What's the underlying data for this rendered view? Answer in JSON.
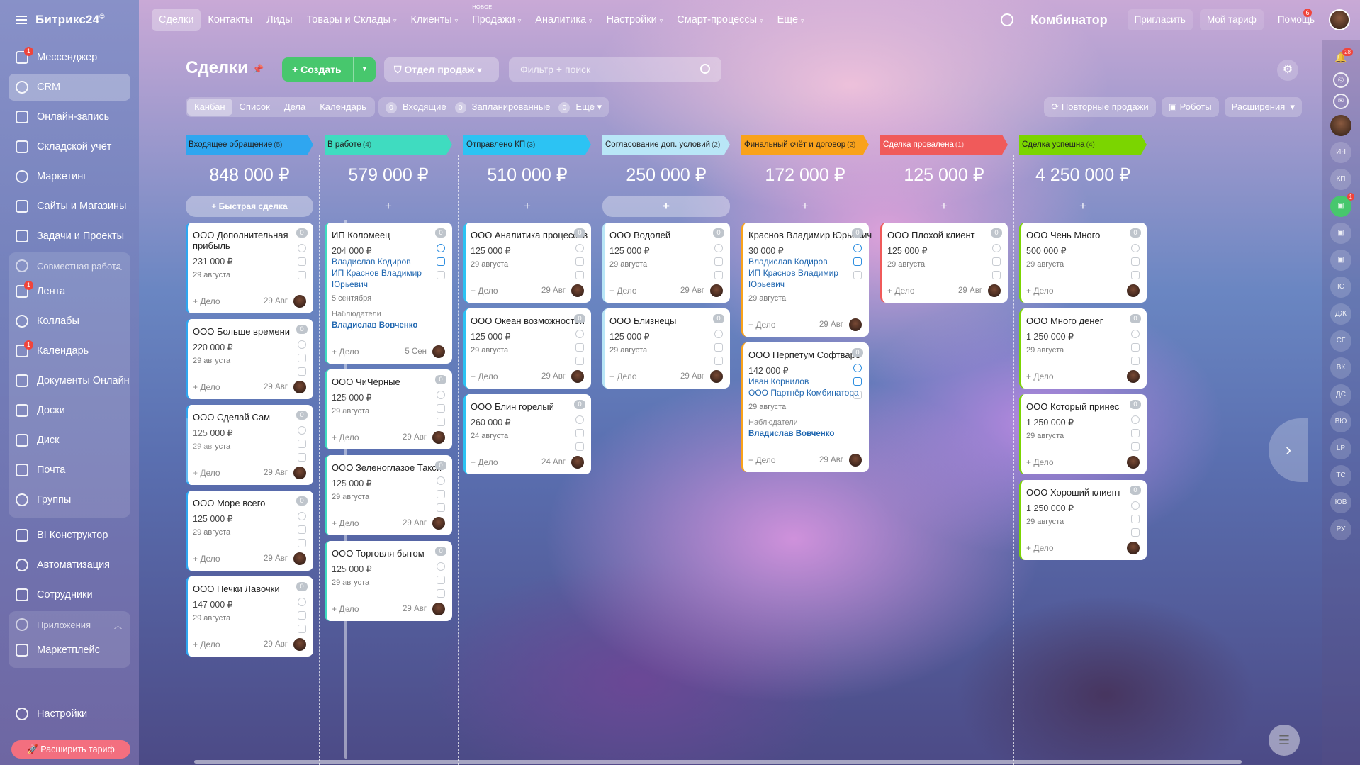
{
  "app": {
    "brand": "Битрикс24",
    "brand_mark": "©",
    "company": "Комбинатор"
  },
  "topnav": {
    "items": [
      {
        "label": "Сделки",
        "active": true
      },
      {
        "label": "Контакты"
      },
      {
        "label": "Лиды"
      },
      {
        "label": "Товары и Склады",
        "caret": true
      },
      {
        "label": "Клиенты",
        "caret": true
      },
      {
        "label": "Продажи",
        "caret": true,
        "new_label": "НОВОЕ"
      },
      {
        "label": "Аналитика",
        "caret": true
      },
      {
        "label": "Настройки",
        "caret": true
      },
      {
        "label": "Смарт-процессы",
        "caret": true
      },
      {
        "label": "Еще",
        "caret": true
      }
    ],
    "invite": "Пригласить",
    "tariff": "Мой тариф",
    "help": "Помощь",
    "help_badge": "6"
  },
  "sidebar": {
    "items": [
      {
        "label": "Мессенджер",
        "badge": "1"
      },
      {
        "label": "CRM",
        "active": true
      },
      {
        "label": "Онлайн-запись"
      },
      {
        "label": "Складской учёт"
      },
      {
        "label": "Маркетинг"
      },
      {
        "label": "Сайты и Магазины"
      },
      {
        "label": "Задачи и Проекты"
      }
    ],
    "group1": {
      "title": "Совместная работа",
      "items": [
        {
          "label": "Лента",
          "badge": "1"
        },
        {
          "label": "Коллабы"
        },
        {
          "label": "Календарь",
          "badge": "1"
        },
        {
          "label": "Документы Онлайн"
        },
        {
          "label": "Доски"
        },
        {
          "label": "Диск"
        },
        {
          "label": "Почта"
        },
        {
          "label": "Группы"
        }
      ]
    },
    "items2": [
      {
        "label": "BI Конструктор"
      },
      {
        "label": "Автоматизация"
      },
      {
        "label": "Сотрудники"
      }
    ],
    "group2": {
      "title": "Приложения",
      "items": [
        {
          "label": "Маркетплейс"
        }
      ]
    },
    "settings": "Настройки",
    "upgrade": "Расширить тариф"
  },
  "page": {
    "title": "Сделки",
    "create": "Создать",
    "department": "Отдел продаж",
    "filter_placeholder": "Фильтр + поиск",
    "views": [
      "Канбан",
      "Список",
      "Дела",
      "Календарь"
    ],
    "counters": [
      {
        "num": "0",
        "label": "Входящие"
      },
      {
        "num": "0",
        "label": "Запланированные"
      },
      {
        "num": "0",
        "label": "Ещё"
      }
    ],
    "repeat_sales": "Повторные продажи",
    "robots": "Роботы",
    "extensions": "Расширения"
  },
  "board": {
    "add_label": "+ Дело",
    "quick_deal": "+ Быстрая сделка",
    "plus": "+",
    "observers_label": "Наблюдатели",
    "columns": [
      {
        "title": "Входящее обращение",
        "count": "(5)",
        "color": "#2fa6f0",
        "dark": false,
        "sum": "848 000 ₽",
        "quick": true,
        "cards": [
          {
            "title": "ООО Дополнительная прибыль",
            "sum": "231 000 ₽",
            "date": "29 августа",
            "deadline": "29 Авг"
          },
          {
            "title": "ООО Больше времени",
            "sum": "220 000 ₽",
            "date": "29 августа",
            "deadline": "29 Авг"
          },
          {
            "title": "ООО Сделай Сам",
            "sum": "125 000 ₽",
            "date": "29 августа",
            "deadline": "29 Авг"
          },
          {
            "title": "ООО Море всего",
            "sum": "125 000 ₽",
            "date": "29 августа",
            "deadline": "29 Авг"
          },
          {
            "title": "ООО Печки Лавочки",
            "sum": "147 000 ₽",
            "date": "29 августа",
            "deadline": "29 Авг"
          }
        ]
      },
      {
        "title": "В работе",
        "count": "(4)",
        "color": "#3fdcc0",
        "dark": false,
        "sum": "579 000 ₽",
        "cards": [
          {
            "title": "ИП Коломеец",
            "sum": "204 000 ₽",
            "links": [
              "Владислав Кодиров",
              "ИП Краснов Владимир Юрьевич"
            ],
            "date": "5 сентября",
            "observer": "Владислав Вовченко",
            "deadline": "5 Сен",
            "active_icons": true
          },
          {
            "title": "ООО ЧиЧёрные",
            "sum": "125 000 ₽",
            "date": "29 августа",
            "deadline": "29 Авг"
          },
          {
            "title": "ООО Зеленоглазое Такси",
            "sum": "125 000 ₽",
            "date": "29 августа",
            "deadline": "29 Авг"
          },
          {
            "title": "ООО Торговля бытом",
            "sum": "125 000 ₽",
            "date": "29 августа",
            "deadline": "29 Авг"
          }
        ]
      },
      {
        "title": "Отправлено КП",
        "count": "(3)",
        "color": "#2cc3f3",
        "dark": false,
        "sum": "510 000 ₽",
        "cards": [
          {
            "title": "ООО Аналитика процессов",
            "sum": "125 000 ₽",
            "date": "29 августа",
            "deadline": "29 Авг"
          },
          {
            "title": "ООО Океан возможностей",
            "sum": "125 000 ₽",
            "date": "29 августа",
            "deadline": "29 Авг"
          },
          {
            "title": "ООО Блин горелый",
            "sum": "260 000 ₽",
            "date": "24 августа",
            "deadline": "24 Авг"
          }
        ]
      },
      {
        "title": "Согласование доп. условий",
        "count": "(2)",
        "color": "#b9e6f7",
        "dark": false,
        "sum": "250 000 ₽",
        "quick_blank": true,
        "cards": [
          {
            "title": "ООО Водолей",
            "sum": "125 000 ₽",
            "date": "29 августа",
            "deadline": "29 Авг"
          },
          {
            "title": "ООО Близнецы",
            "sum": "125 000 ₽",
            "date": "29 августа",
            "deadline": "29 Авг"
          }
        ]
      },
      {
        "title": "Финальный счёт и договор",
        "count": "(2)",
        "color": "#f9a21b",
        "dark": false,
        "sum": "172 000 ₽",
        "cards": [
          {
            "title": "Краснов Владимир Юрьевич",
            "sum": "30 000 ₽",
            "links": [
              "Владислав Кодиров",
              "ИП Краснов Владимир Юрьевич"
            ],
            "date": "29 августа",
            "deadline": "29 Авг",
            "active_icons": true
          },
          {
            "title": "ООО Перпетум Софтваре",
            "sum": "142 000 ₽",
            "links": [
              "Иван Корнилов",
              "ООО Партнёр Комбинатора"
            ],
            "date": "29 августа",
            "observer": "Владислав Вовченко",
            "deadline": "29 Авг",
            "active_icons": true
          }
        ]
      },
      {
        "title": "Сделка провалена",
        "count": "(1)",
        "color": "#f05a5a",
        "dark": true,
        "sum": "125 000 ₽",
        "cards": [
          {
            "title": "ООО Плохой клиент",
            "sum": "125 000 ₽",
            "date": "29 августа",
            "deadline": "29 Авг"
          }
        ]
      },
      {
        "title": "Сделка успешна",
        "count": "(4)",
        "color": "#7bd500",
        "dark": false,
        "sum": "4 250 000 ₽",
        "cards": [
          {
            "title": "ООО Чень Много",
            "sum": "500 000 ₽",
            "date": "29 августа"
          },
          {
            "title": "ООО Много денег",
            "sum": "1 250 000 ₽",
            "date": "29 августа"
          },
          {
            "title": "ООО Который принес",
            "sum": "1 250 000 ₽",
            "date": "29 августа"
          },
          {
            "title": "ООО Хороший клиент",
            "sum": "1 250 000 ₽",
            "date": "29 августа"
          }
        ]
      }
    ]
  },
  "rail": {
    "notif_badge": "28",
    "chat_badge": "1",
    "users": [
      "ИЧ",
      "КП",
      "IC",
      "ДЖ",
      "СГ",
      "ВК",
      "ДС",
      "ВЮ",
      "LP",
      "ТС",
      "ЮВ",
      "РУ"
    ]
  }
}
